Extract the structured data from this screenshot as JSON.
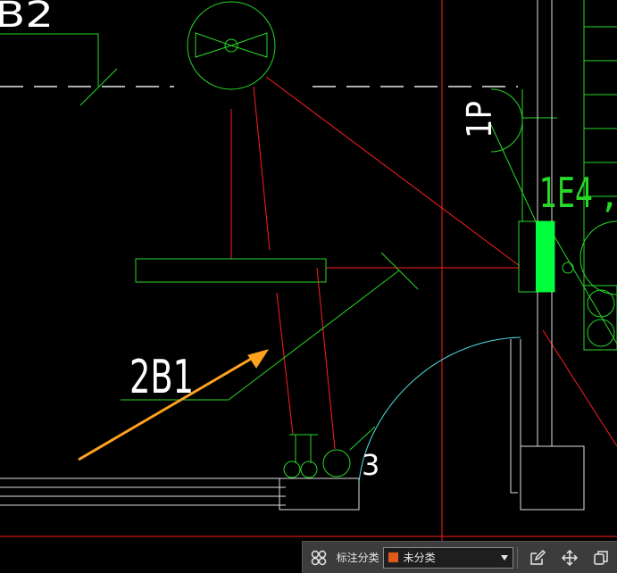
{
  "drawing": {
    "label_2b1": "2B1",
    "label_1e4": "1E4",
    "label_comma": ",",
    "label_1p": "1P",
    "label_b2": "B2",
    "label_3": "3"
  },
  "toolbar": {
    "label": "标注分类",
    "selected_category": "未分类",
    "category_color": "#e05a1a"
  }
}
